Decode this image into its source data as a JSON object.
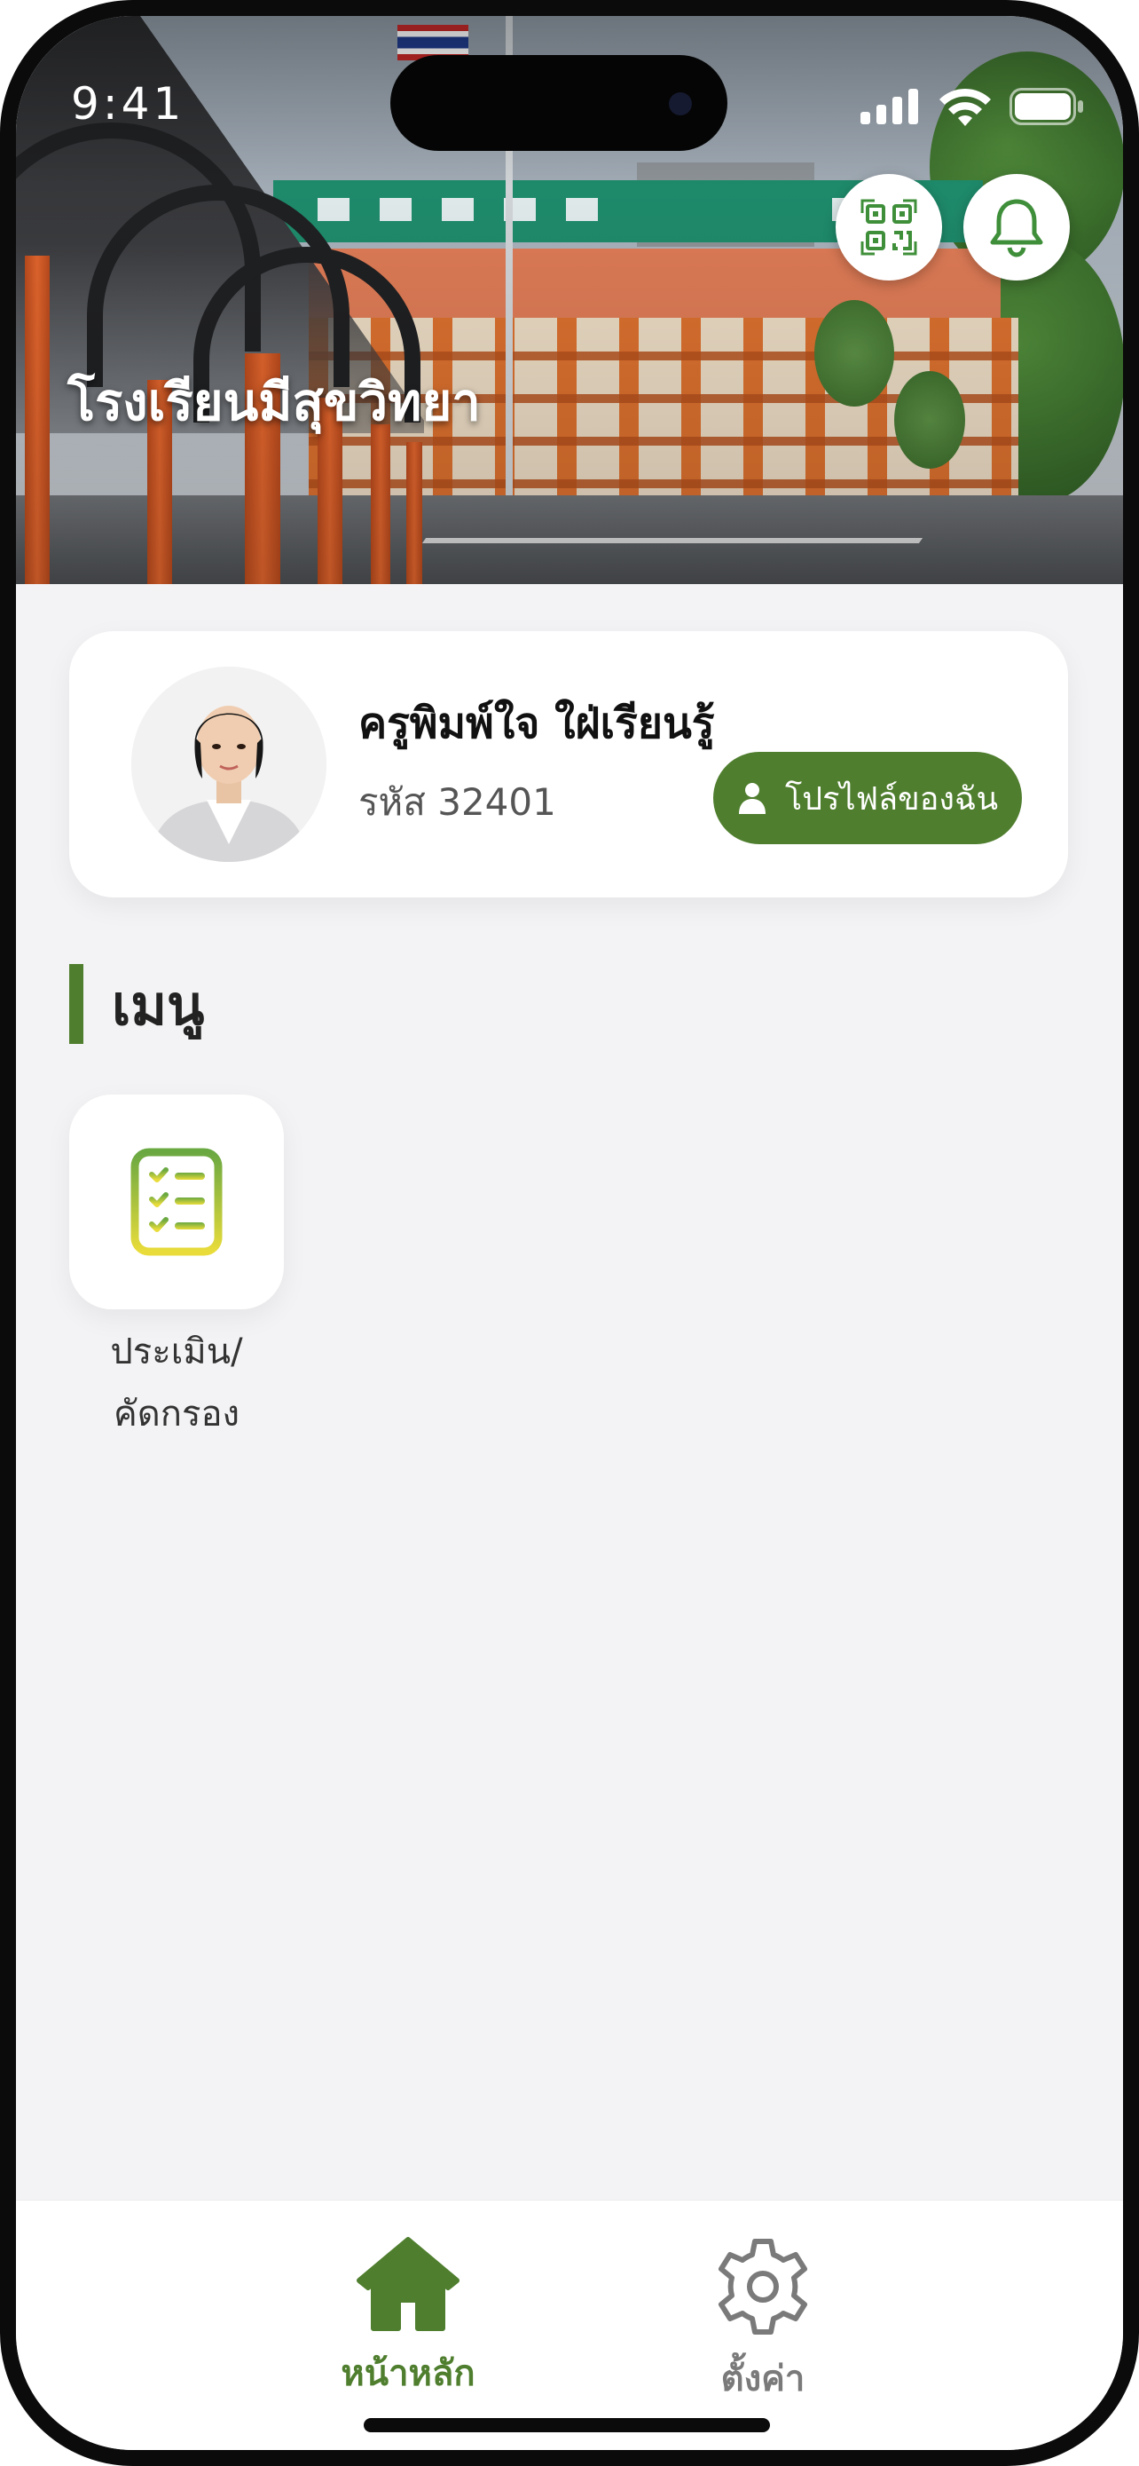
{
  "status_bar": {
    "time": "9:41"
  },
  "header": {
    "school_name": "โรงเรียนมีสุขวิทยา"
  },
  "profile": {
    "name": "ครูพิมพ์ใจ ใฝ่เรียนรู้",
    "code": "รหัส 32401",
    "button_label": "โปรไฟล์ของฉัน"
  },
  "menu": {
    "title": "เมนู",
    "items": [
      {
        "label": "ประเมิน/\nคัดกรอง",
        "icon": "checklist-icon"
      }
    ]
  },
  "tabs": [
    {
      "label": "หน้าหลัก",
      "icon": "home-icon",
      "active": true
    },
    {
      "label": "ตั้งค่า",
      "icon": "gear-icon",
      "active": false
    }
  ],
  "colors": {
    "accent": "#4f7e2e",
    "qr_icon": "#3f8f3a",
    "inactive": "#7a7a7a"
  }
}
